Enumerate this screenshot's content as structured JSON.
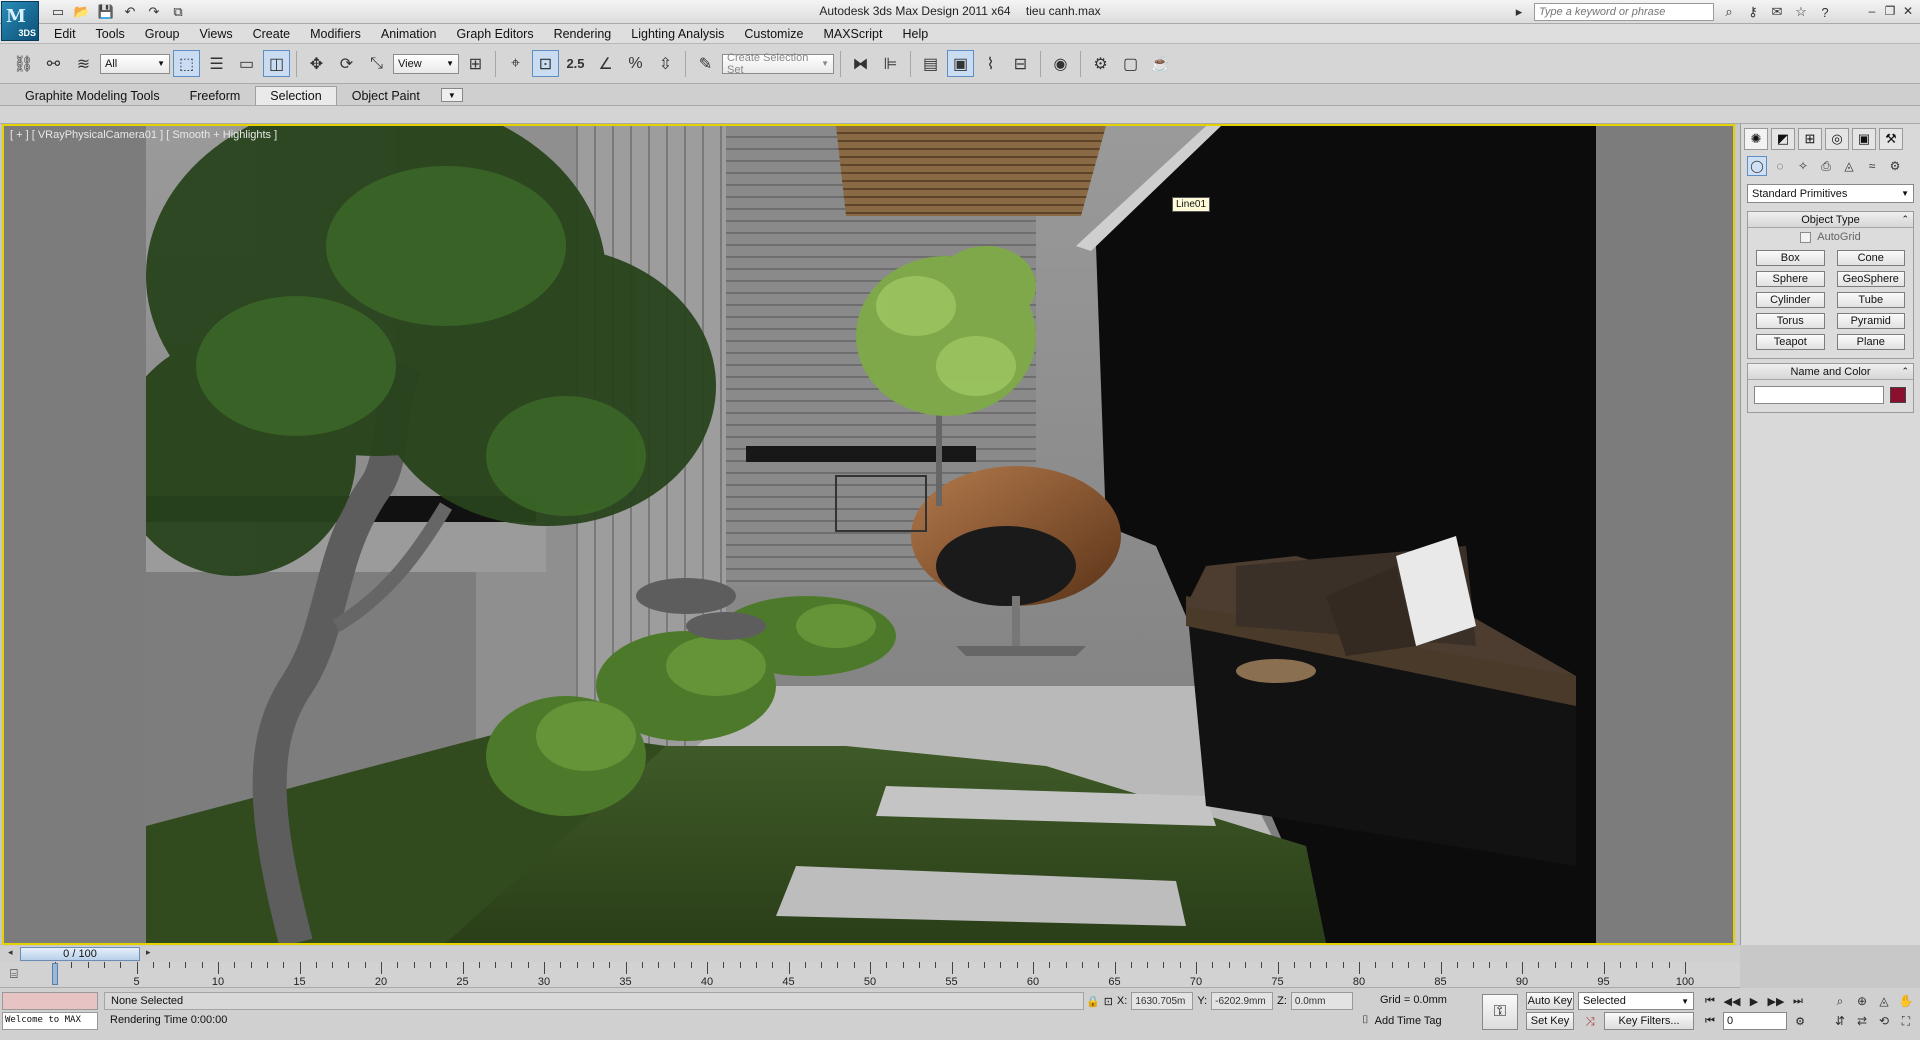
{
  "app": {
    "logo_text": "3DS",
    "title": "Autodesk 3ds Max Design 2011 x64",
    "file": "tieu canh.max"
  },
  "quick_access": [
    "new-icon",
    "open-icon",
    "save-icon",
    "undo-icon",
    "redo-icon",
    "project-folder-icon"
  ],
  "search": {
    "placeholder": "Type a keyword or phrase"
  },
  "menu": [
    "Edit",
    "Tools",
    "Group",
    "Views",
    "Create",
    "Modifiers",
    "Animation",
    "Graph Editors",
    "Rendering",
    "Lighting Analysis",
    "Customize",
    "MAXScript",
    "Help"
  ],
  "toolbar": {
    "selection_filter": "All",
    "reference_coord": "View",
    "snap_value": "2.5",
    "named_selection_placeholder": "Create Selection Set"
  },
  "ribbon": {
    "tabs": [
      "Graphite Modeling Tools",
      "Freeform",
      "Selection",
      "Object Paint"
    ],
    "active_tab": "Selection"
  },
  "viewport": {
    "label": "[ + ] [ VRayPhysicalCamera01 ] [ Smooth + Highlights ]",
    "tooltip": "Line01",
    "border_color": "#e4d200"
  },
  "command_panel": {
    "category": "Standard Primitives",
    "object_type_title": "Object Type",
    "autogrid_label": "AutoGrid",
    "primitives": [
      "Box",
      "Cone",
      "Sphere",
      "GeoSphere",
      "Cylinder",
      "Tube",
      "Torus",
      "Pyramid",
      "Teapot",
      "Plane"
    ],
    "name_color_title": "Name and Color",
    "name_value": "",
    "color": "#8b1030"
  },
  "timeline": {
    "thumb_label": "0 / 100",
    "ticks": [
      "0",
      "5",
      "10",
      "15",
      "20",
      "25",
      "30",
      "35",
      "40",
      "45",
      "50",
      "55",
      "60",
      "65",
      "70",
      "75",
      "80",
      "85",
      "90",
      "95",
      "100"
    ]
  },
  "status": {
    "maxscript_output": "Welcome to MAX",
    "selection": "None Selected",
    "prompt": "Rendering Time  0:00:00",
    "x_label": "X:",
    "x_value": "1630.705m",
    "y_label": "Y:",
    "y_value": "-6202.9mm",
    "z_label": "Z:",
    "z_value": "0.0mm",
    "grid": "Grid = 0.0mm",
    "add_time_tag": "Add Time Tag",
    "auto_key": "Auto Key",
    "set_key": "Set Key",
    "selected_dropdown": "Selected",
    "key_filters": "Key Filters...",
    "current_frame": "0"
  }
}
